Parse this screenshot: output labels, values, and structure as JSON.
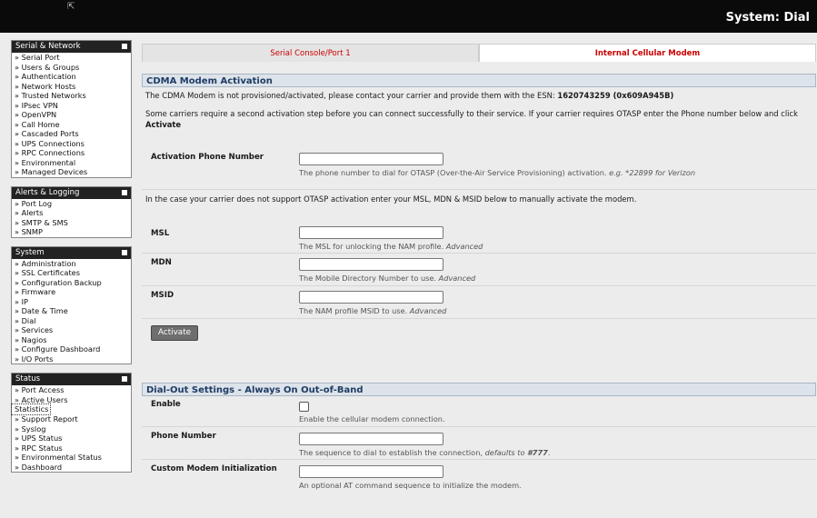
{
  "header": {
    "title": "System: Dial"
  },
  "sidebar": {
    "sections": [
      {
        "title": "Serial & Network",
        "items": [
          "» Serial Port",
          "» Users & Groups",
          "» Authentication",
          "» Network Hosts",
          "» Trusted Networks",
          "» IPsec VPN",
          "» OpenVPN",
          "» Call Home",
          "» Cascaded Ports",
          "» UPS Connections",
          "» RPC Connections",
          "» Environmental",
          "» Managed Devices"
        ]
      },
      {
        "title": "Alerts & Logging",
        "items": [
          "» Port Log",
          "» Alerts",
          "» SMTP & SMS",
          "» SNMP"
        ]
      },
      {
        "title": "System",
        "items": [
          "» Administration",
          "» SSL Certificates",
          "» Configuration Backup",
          "» Firmware",
          "» IP",
          "» Date & Time",
          "» Dial",
          "» Services",
          "» Nagios",
          "» Configure Dashboard",
          "» I/O Ports"
        ]
      },
      {
        "title": "Status",
        "items": [
          "» Port Access",
          "» Active Users",
          "Statistics",
          "» Support Report",
          "» Syslog",
          "» UPS Status",
          "» RPC Status",
          "» Environmental Status",
          "» Dashboard"
        ]
      }
    ]
  },
  "tabs": [
    {
      "label": "Serial Console/Port 1"
    },
    {
      "label": "Internal Cellular Modem"
    }
  ],
  "activation": {
    "heading": "CDMA Modem Activation",
    "esn_text": "The CDMA Modem is not provisioned/activated, please contact your carrier and provide them with the ESN: ",
    "esn_value": "1620743259 (0x609A945B)",
    "otasp_text": "Some carriers require a second activation step before you can connect successfully to their service. If your carrier requires OTASP enter the Phone number below and click ",
    "otasp_bold": "Activate",
    "phone_label": "Activation Phone Number",
    "phone_value": "",
    "phone_hint": "The phone number to dial for OTASP (Over-the-Air Service Provisioning) activation. ",
    "phone_hint_em": "e.g. *22899 for Verizon",
    "manual_text": "In the case your carrier does not support OTASP activation enter your MSL, MDN & MSID below to manually activate the modem.",
    "msl_label": "MSL",
    "msl_value": "",
    "msl_hint": "The MSL for unlocking the NAM profile. ",
    "msl_hint_em": "Advanced",
    "mdn_label": "MDN",
    "mdn_value": "",
    "mdn_hint": "The Mobile Directory Number to use. ",
    "mdn_hint_em": "Advanced",
    "msid_label": "MSID",
    "msid_value": "",
    "msid_hint": "The NAM profile MSID to use. ",
    "msid_hint_em": "Advanced",
    "activate_button": "Activate"
  },
  "dialout": {
    "heading": "Dial-Out Settings - Always On Out-of-Band",
    "enable_label": "Enable",
    "enable_checked": false,
    "enable_hint": "Enable the cellular modem connection.",
    "phone_label": "Phone Number",
    "phone_value": "",
    "phone_hint": "The sequence to dial to establish the connection, ",
    "phone_hint_em": "defaults to ",
    "phone_hint_bold": "#777",
    "phone_hint_end": ".",
    "init_label": "Custom Modem Initialization",
    "init_value": "",
    "init_hint": "An optional AT command sequence to initialize the modem."
  }
}
